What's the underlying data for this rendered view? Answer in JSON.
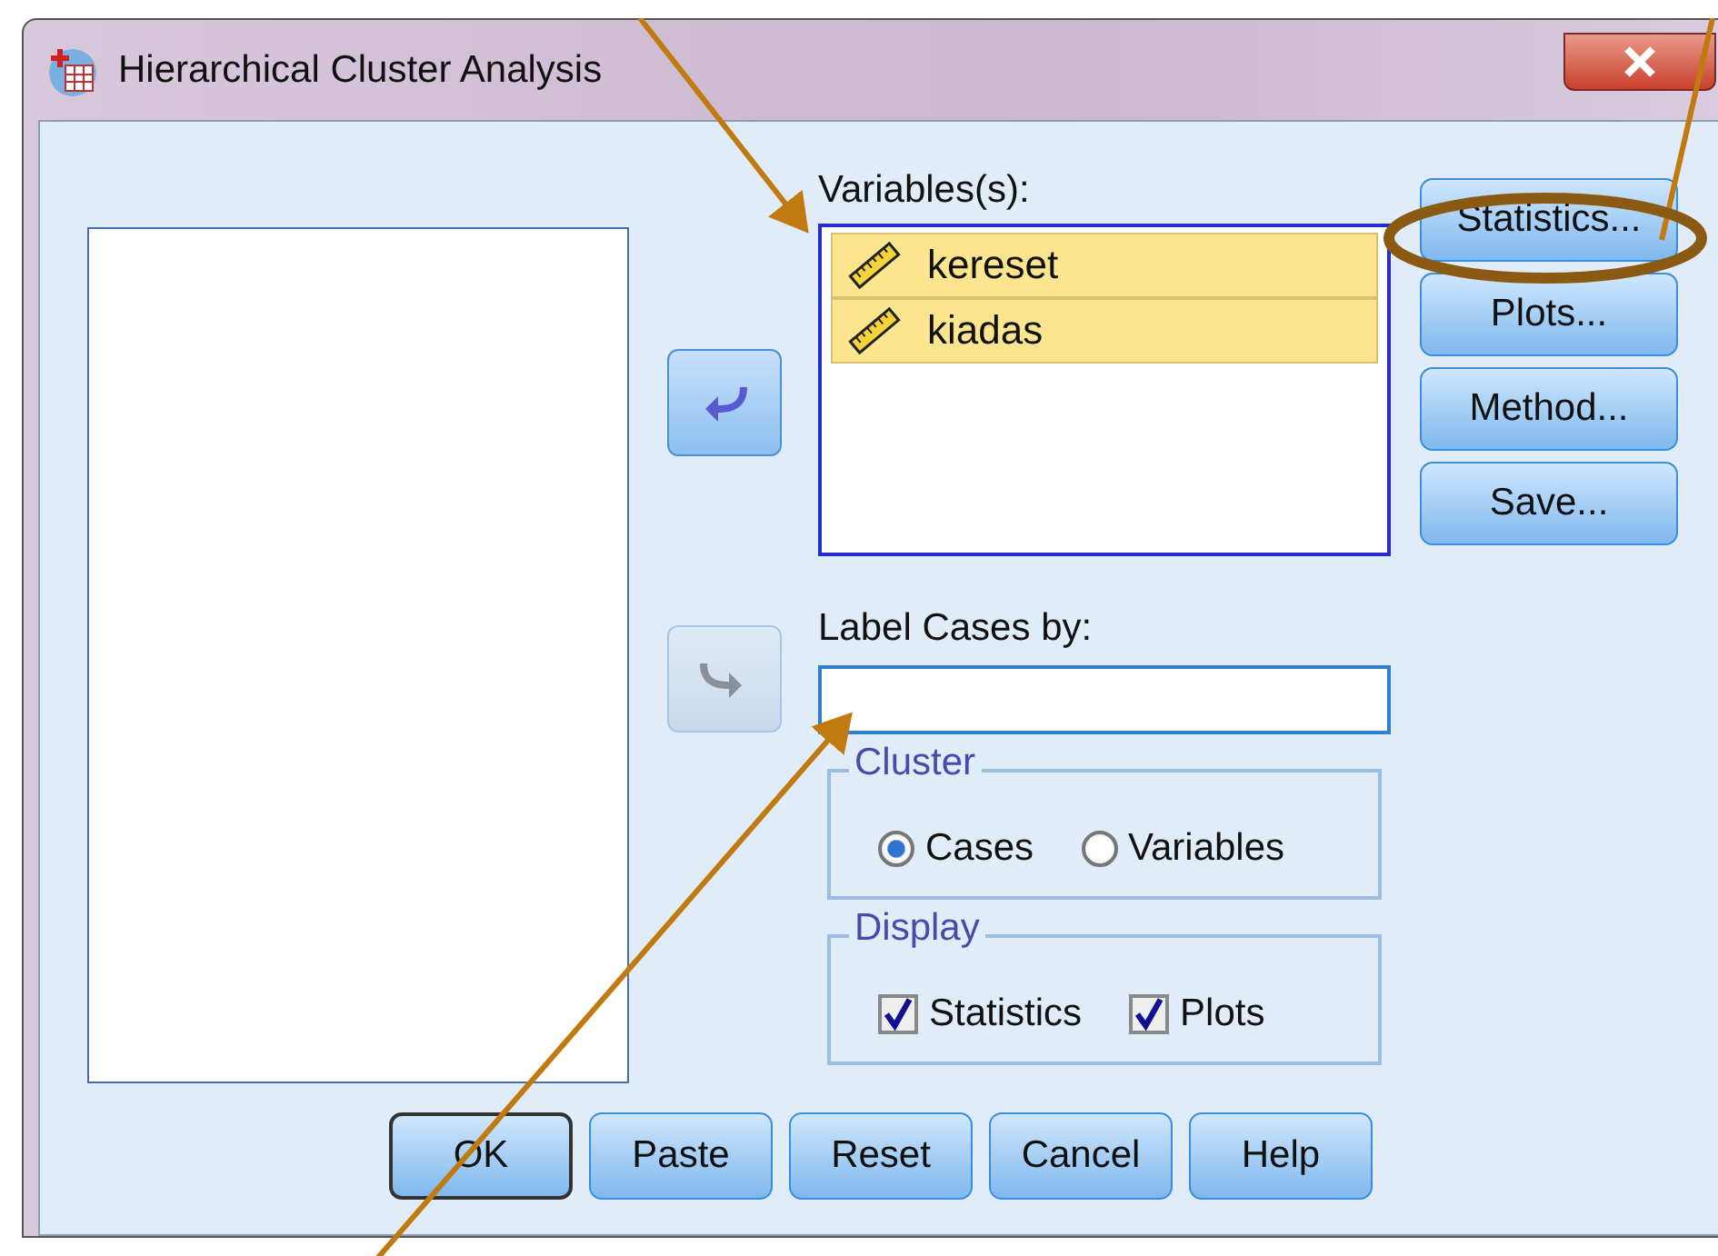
{
  "window": {
    "title": "Hierarchical Cluster Analysis"
  },
  "move_buttons": [
    {
      "kind": "left",
      "disabled": false
    },
    {
      "kind": "right",
      "disabled": true
    }
  ],
  "variables": {
    "label": "Variables(s):",
    "items": [
      {
        "name": "kereset",
        "selected": true
      },
      {
        "name": "kiadas",
        "selected": true
      }
    ]
  },
  "label_cases": {
    "label": "Label Cases by:"
  },
  "cluster": {
    "title": "Cluster",
    "options": [
      {
        "label": "Cases",
        "selected": true
      },
      {
        "label": "Variables",
        "selected": false
      }
    ]
  },
  "display": {
    "title": "Display",
    "options": [
      {
        "label": "Statistics",
        "checked": true
      },
      {
        "label": "Plots",
        "checked": true
      }
    ]
  },
  "side_buttons": [
    {
      "label": "Statistics..."
    },
    {
      "label": "Plots..."
    },
    {
      "label": "Method..."
    },
    {
      "label": "Save..."
    }
  ],
  "bottom_buttons": [
    {
      "label": "OK",
      "default": true
    },
    {
      "label": "Paste",
      "default": false
    },
    {
      "label": "Reset",
      "default": false
    },
    {
      "label": "Cancel",
      "default": false
    },
    {
      "label": "Help",
      "default": false
    }
  ]
}
